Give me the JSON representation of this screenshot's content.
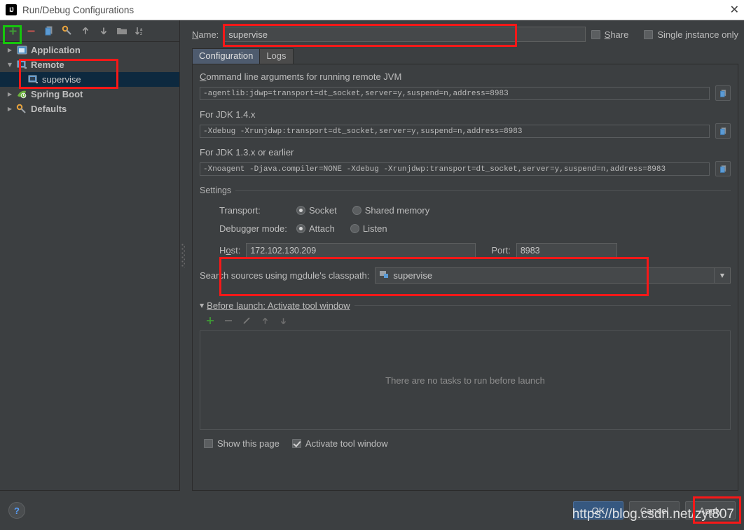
{
  "window": {
    "title": "Run/Debug Configurations",
    "logo": "intellij-idea-logo",
    "close_label": "✕"
  },
  "sidebar": {
    "toolbar": [
      {
        "name": "add",
        "glyph": "+",
        "color": "#3f9c35"
      },
      {
        "name": "remove",
        "glyph": "–",
        "color": "#c75450"
      },
      {
        "name": "copy-configuration",
        "glyph": "copy",
        "color": "#6ba4d8"
      },
      {
        "name": "edit-defaults",
        "glyph": "wrench",
        "color": "#e8a33d"
      },
      {
        "name": "move-up",
        "glyph": "↑",
        "color": "#9a9a9a"
      },
      {
        "name": "move-down",
        "glyph": "↓",
        "color": "#9a9a9a"
      },
      {
        "name": "create-folder",
        "glyph": "folder",
        "color": "#8c8c8c"
      },
      {
        "name": "sort-alphabetically",
        "glyph": "sort-az",
        "color": "#9a9a9a"
      }
    ],
    "tree": [
      {
        "label": "Application",
        "icon": "application-icon",
        "twisty": "▶",
        "level": 0,
        "selected": false
      },
      {
        "label": "Remote",
        "icon": "remote-icon",
        "twisty": "▼",
        "level": 0,
        "selected": false
      },
      {
        "label": "supervise",
        "icon": "remote-icon",
        "twisty": "",
        "level": 1,
        "selected": true
      },
      {
        "label": "Spring Boot",
        "icon": "spring-boot-icon",
        "twisty": "▶",
        "level": 0,
        "selected": false
      },
      {
        "label": "Defaults",
        "icon": "defaults-icon",
        "twisty": "▶",
        "level": 0,
        "selected": false
      }
    ]
  },
  "header": {
    "name_label": "Name:",
    "name_value": "supervise",
    "share_label": "Share",
    "share_checked": false,
    "single_instance_label": "Single instance only",
    "single_instance_checked": false
  },
  "tabs": [
    {
      "label": "Configuration",
      "active": true
    },
    {
      "label": "Logs",
      "active": false
    }
  ],
  "configuration": {
    "args_title": "Command line arguments for running remote JVM",
    "args_value": "-agentlib:jdwp=transport=dt_socket,server=y,suspend=n,address=8983",
    "jdk14_title": "For JDK 1.4.x",
    "jdk14_value": "-Xdebug -Xrunjdwp:transport=dt_socket,server=y,suspend=n,address=8983",
    "jdk13_title": "For JDK 1.3.x or earlier",
    "jdk13_value": "-Xnoagent -Djava.compiler=NONE -Xdebug -Xrunjdwp:transport=dt_socket,server=y,suspend=n,address=8983",
    "copy_icon": "copy-to-clipboard-icon",
    "settings_legend": "Settings",
    "transport_label": "Transport:",
    "transport_options": [
      {
        "label": "Socket",
        "selected": true
      },
      {
        "label": "Shared memory",
        "selected": false
      }
    ],
    "debugger_mode_label": "Debugger mode:",
    "debugger_mode_options": [
      {
        "label": "Attach",
        "selected": true
      },
      {
        "label": "Listen",
        "selected": false
      }
    ],
    "host_label": "Host:",
    "host_value": "172.102.130.209",
    "port_label": "Port:",
    "port_value": "8983",
    "classpath_label": "Search sources using module's classpath:",
    "classpath_value": "supervise",
    "classpath_icon": "module-icon",
    "classpath_arrow": "▼"
  },
  "before_launch": {
    "twisty": "▼",
    "title": "Before launch: Activate tool window",
    "toolbar": [
      {
        "name": "add-task",
        "glyph": "+",
        "color": "#3f9c35"
      },
      {
        "name": "remove-task",
        "glyph": "–",
        "color": "#6d6d6d"
      },
      {
        "name": "edit-task",
        "glyph": "pencil",
        "color": "#7a7a7a"
      },
      {
        "name": "move-task-up",
        "glyph": "↑",
        "color": "#6d6d6d"
      },
      {
        "name": "move-task-down",
        "glyph": "↓",
        "color": "#6d6d6d"
      }
    ],
    "empty_message": "There are no tasks to run before launch",
    "show_page_label": "Show this page",
    "show_page_checked": false,
    "activate_tool_window_label": "Activate tool window",
    "activate_tool_window_checked": true
  },
  "footer": {
    "help_glyph": "?",
    "ok_label": "OK",
    "cancel_label": "Cancel",
    "apply_label": "Apply"
  },
  "watermark": "https://blog.csdn.net/zyt807",
  "colors": {
    "annotation_red": "#f71818",
    "annotation_green": "#16c60c",
    "default_button": "#365880",
    "selection": "#0d293f"
  }
}
